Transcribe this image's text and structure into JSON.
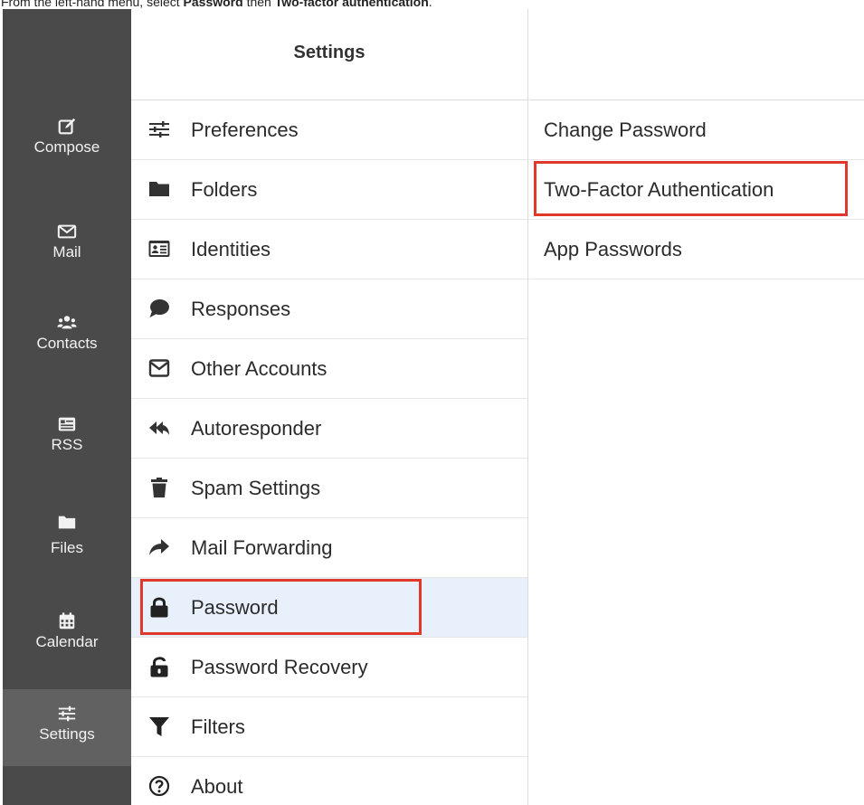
{
  "caption": {
    "prefix": "From the left-hand menu, select ",
    "bold1": "Password",
    "middle": " then ",
    "bold2": "Two-factor authentication",
    "suffix": "."
  },
  "rail": {
    "items": [
      {
        "label": "Compose",
        "icon": "compose-icon"
      },
      {
        "label": "Mail",
        "icon": "envelope-icon"
      },
      {
        "label": "Contacts",
        "icon": "users-icon"
      },
      {
        "label": "RSS",
        "icon": "rss-icon"
      },
      {
        "label": "Files",
        "icon": "folder-icon"
      },
      {
        "label": "Calendar",
        "icon": "calendar-icon"
      },
      {
        "label": "Settings",
        "icon": "sliders-icon",
        "active": true
      }
    ]
  },
  "settings": {
    "title": "Settings",
    "items": [
      {
        "label": "Preferences",
        "icon": "sliders-icon"
      },
      {
        "label": "Folders",
        "icon": "folder-icon"
      },
      {
        "label": "Identities",
        "icon": "id-card-icon"
      },
      {
        "label": "Responses",
        "icon": "comment-icon"
      },
      {
        "label": "Other Accounts",
        "icon": "envelope-outline-icon"
      },
      {
        "label": "Autoresponder",
        "icon": "reply-all-icon"
      },
      {
        "label": "Spam Settings",
        "icon": "trash-icon"
      },
      {
        "label": "Mail Forwarding",
        "icon": "share-arrow-icon"
      },
      {
        "label": "Password",
        "icon": "lock-icon",
        "selected": true
      },
      {
        "label": "Password Recovery",
        "icon": "unlock-icon"
      },
      {
        "label": "Filters",
        "icon": "filter-icon"
      },
      {
        "label": "About",
        "icon": "question-circle-icon"
      }
    ]
  },
  "password_menu": {
    "items": [
      {
        "label": "Change Password"
      },
      {
        "label": "Two-Factor Authentication"
      },
      {
        "label": "App Passwords"
      }
    ]
  },
  "colors": {
    "rail_bg": "#4a4a4a",
    "rail_active": "#616161",
    "selected_bg": "#e8f1fb",
    "highlight": "#e0382a"
  }
}
